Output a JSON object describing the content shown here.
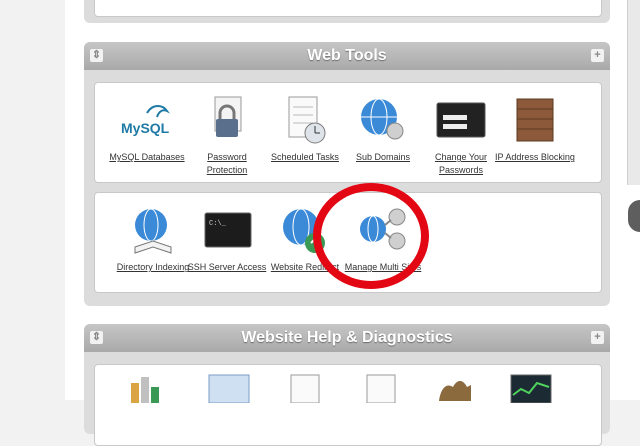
{
  "panels": {
    "web_tools": {
      "title": "Web Tools",
      "collapse_icon": "collapse-icon",
      "expand_icon": "plus-icon"
    },
    "diagnostics": {
      "title": "Website Help & Diagnostics"
    }
  },
  "web_tools_rows": {
    "row1": [
      {
        "label": "MySQL Databases",
        "icon": "mysql-logo-icon"
      },
      {
        "label": "Password Protection",
        "icon": "password-lock-icon"
      },
      {
        "label": "Scheduled Tasks",
        "icon": "calendar-clock-icon"
      },
      {
        "label": "Sub Domains",
        "icon": "globe-network-icon"
      },
      {
        "label": "Change Your Passwords",
        "icon": "password-window-icon"
      },
      {
        "label": "IP Address Blocking",
        "icon": "brick-wall-icon"
      }
    ],
    "row2": [
      {
        "label": "Directory Indexing",
        "icon": "globe-book-icon"
      },
      {
        "label": "SSH Server Access",
        "icon": "terminal-icon"
      },
      {
        "label": "Website Redirect",
        "icon": "globe-redirect-icon"
      },
      {
        "label": "Manage Multi Sites",
        "icon": "network-nodes-icon"
      }
    ]
  },
  "mysql_logo_text": "MySQL"
}
